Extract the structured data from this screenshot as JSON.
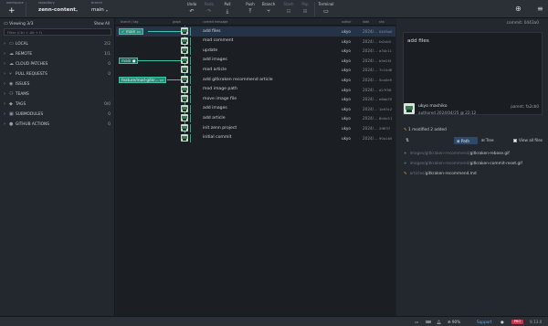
{
  "toolbar": {
    "workspace_label": "workspace",
    "repository_label": "repository",
    "repository_name": "zenn-content",
    "branch_label": "branch",
    "branch_name": "main",
    "actions": [
      {
        "label": "Undo",
        "icon": "undo-icon",
        "enabled": true
      },
      {
        "label": "Redo",
        "icon": "redo-icon",
        "enabled": false
      },
      {
        "label": "Pull",
        "icon": "pull-icon",
        "enabled": true
      },
      {
        "label": "Push",
        "icon": "push-icon",
        "enabled": true
      },
      {
        "label": "Branch",
        "icon": "branch-icon",
        "enabled": true
      },
      {
        "label": "Stash",
        "icon": "stash-icon",
        "enabled": false
      },
      {
        "label": "Pop",
        "icon": "pop-icon",
        "enabled": false
      },
      {
        "label": "Terminal",
        "icon": "terminal-icon",
        "enabled": true
      }
    ]
  },
  "left_panel": {
    "viewing": "Viewing 3/3",
    "show_all": "Show All",
    "filter_placeholder": "Filter (Ctrl + Alt + f)",
    "sections": [
      {
        "label": "LOCAL",
        "count": "2/2",
        "icon": "monitor-icon"
      },
      {
        "label": "REMOTE",
        "count": "1/1",
        "icon": "cloud-icon"
      },
      {
        "label": "CLOUD PATCHES",
        "count": "0",
        "icon": "cloud-patch-icon"
      },
      {
        "label": "PULL REQUESTS",
        "count": "0",
        "icon": "pull-request-icon"
      },
      {
        "label": "ISSUES",
        "count": "",
        "icon": "issue-icon"
      },
      {
        "label": "TEAMS",
        "count": "",
        "icon": "team-icon"
      },
      {
        "label": "TAGS",
        "count": "0/0",
        "icon": "tag-icon"
      },
      {
        "label": "SUBMODULES",
        "count": "0",
        "icon": "submodule-icon"
      },
      {
        "label": "GITHUB ACTIONS",
        "count": "0",
        "icon": "github-icon"
      }
    ]
  },
  "graph": {
    "col_branch": "branch / tag",
    "col_graph": "graph",
    "col_message": "commit message",
    "col_author": "author",
    "col_date": "date",
    "col_sha": "sha",
    "branches": {
      "main": "main",
      "main_remote": "main",
      "feature": "feature/mod-gitkr..."
    },
    "commits": [
      {
        "message": "add files",
        "author": "ukyo",
        "date": "2024/...",
        "sha": "0443a0"
      },
      {
        "message": "mod comment",
        "author": "ukyo",
        "date": "2024/...",
        "sha": "fa2cb0"
      },
      {
        "message": "update",
        "author": "ukyo",
        "date": "2024/...",
        "sha": "a34c11"
      },
      {
        "message": "add images",
        "author": "ukyo",
        "date": "2024/...",
        "sha": "b9e2f4"
      },
      {
        "message": "mod article",
        "author": "ukyo",
        "date": "2024/...",
        "sha": "7c10d8"
      },
      {
        "message": "add gitkraken recommend article",
        "author": "ukyo",
        "date": "2024/...",
        "sha": "5ca0e9"
      },
      {
        "message": "mod image path",
        "author": "ukyo",
        "date": "2024/...",
        "sha": "d27f56"
      },
      {
        "message": "move image file",
        "author": "ukyo",
        "date": "2024/...",
        "sha": "e6ab70"
      },
      {
        "message": "add images",
        "author": "ukyo",
        "date": "2024/...",
        "sha": "1b93c2"
      },
      {
        "message": "add article",
        "author": "ukyo",
        "date": "2024/...",
        "sha": "8d4e11"
      },
      {
        "message": "init zenn project",
        "author": "ukyo",
        "date": "2024/...",
        "sha": "2f6f37"
      },
      {
        "message": "initial commit",
        "author": "ukyo",
        "date": "2024/...",
        "sha": "90a1b5"
      }
    ]
  },
  "right_panel": {
    "commit_label": "commit: 0443a0",
    "summary": "add files",
    "author_name": "ukyo mashiko",
    "authored": "authored 2024/04/25 @ 22:12",
    "parent": "parent: fa2cb0",
    "changes": "1 modified   2 added",
    "sort_icon": "sort-icon",
    "path_label": "Path",
    "tree_label": "Tree",
    "show_all_files": "View all files",
    "files": [
      {
        "status": "added",
        "dir": "images/gitkraken-recommend/",
        "name": "gitkraken-rebase.gif"
      },
      {
        "status": "added",
        "dir": "images/gitkraken-recommend/",
        "name": "gitkraken-commit-reset.gif"
      },
      {
        "status": "modified",
        "dir": "articles/",
        "name": "gitkraken-recommend.md"
      }
    ]
  },
  "status_bar": {
    "zoom": "90%",
    "support": "Support",
    "pro": "PRO",
    "version": "9.13.0"
  },
  "colors": {
    "accent_teal": "#3bc4a6",
    "selection": "#253348",
    "pro_badge": "#c8374b"
  }
}
